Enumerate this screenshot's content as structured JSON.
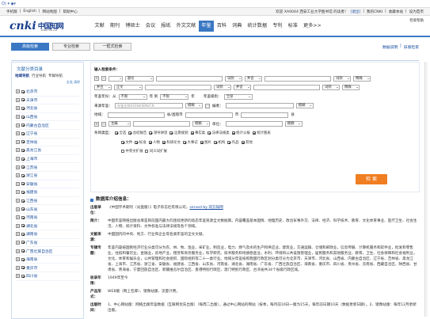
{
  "browser": {
    "dots": "O) ▾ ◆▾"
  },
  "topbar": {
    "links": [
      "手机版",
      "English",
      "网站地图",
      "帮助中心"
    ],
    "welcome": "欢迎 XA0044 西安工业大学图书馆 的读者！",
    "exit": "[退出]",
    "my_cnki": "我的CNKI",
    "collect": "收藏本站",
    "home": "设为首页"
  },
  "logo": {
    "brand": "cnki",
    "cn": "中国知网",
    "sub": "www.cnki.net"
  },
  "nav": {
    "items": [
      "文献",
      "期刊",
      "博硕士",
      "会议",
      "报纸",
      "外文文献",
      "年鉴",
      "百科",
      "词典",
      "统计数据",
      "专利",
      "标准",
      "更多>>"
    ],
    "active": "年鉴"
  },
  "header_util": {
    "help": "检索帮助",
    "feedback": "建议反馈"
  },
  "tabs": [
    "高级检索",
    "专业检索",
    "一框式检索"
  ],
  "right_links": {
    "new_func": "数据说明",
    "old": "旧版检索"
  },
  "side": {
    "title": "文献分类目录",
    "tabs": [
      "地域导航",
      "行业导航",
      "专辑导航"
    ],
    "select_all": "全选",
    "clear": "清除",
    "items": [
      "北京市",
      "天津市",
      "河北省",
      "山西省",
      "内蒙古自治区",
      "辽宁省",
      "吉林省",
      "黑龙江省",
      "上海市",
      "江苏省",
      "浙江省",
      "安徽省",
      "福建省",
      "江西省",
      "山东省",
      "河南省",
      "湖北省",
      "湖南省",
      "广东省",
      "广西壮族自治区",
      "海南省",
      "重庆市",
      "四川省"
    ]
  },
  "form": {
    "title": "输入检索条件：",
    "r1": {
      "field": "题名",
      "freq": "词频",
      "logic": "并含",
      "freq2": "词频",
      "match": "精确"
    },
    "r2": {
      "op": "并且",
      "field": "正文",
      "freq": "词频",
      "logic": "并含",
      "freq2": "词频",
      "match": "精确"
    },
    "year_label": "年鉴年份：从",
    "year_from": "不限",
    "year_to_label": "年 到",
    "year_to": "不限",
    "year_unit": "年",
    "level_label": "年鉴级别：",
    "level": "全部",
    "source_label": "来源年鉴：",
    "source_placeholder": "年鉴名称/ISSN/ISBN/CN",
    "source_match": "模糊",
    "editor_label": "编者：",
    "editor_match": "模糊",
    "region_label": "地域：",
    "province": "省/直辖市",
    "city": "市",
    "county": "县",
    "author_field": "主编",
    "author_match": "模糊",
    "unit_label": "单位：",
    "unit_match": "模糊",
    "type_label": "条目类型：",
    "types1": [
      "全选",
      "总结报告",
      "领导讲话",
      "远景规划",
      "事实类",
      "法律法规类",
      "统计公报",
      "统计图表"
    ],
    "types2": [
      "文件",
      "标准",
      "人物",
      "科研论文",
      "大事记",
      "图片",
      "机构",
      "作品",
      "其他"
    ],
    "options": [
      "中英文扩展",
      "同义词扩展"
    ],
    "search": "检 索"
  },
  "intro": {
    "heading": "数据库介绍信息：",
    "rows": [
      {
        "k": "出版单位：",
        "v": "《中国学术期刊（光盘版）》电子杂志社有限公司，",
        "link": "served by 同方知网"
      },
      {
        "k": "简介：",
        "v": "中国年鉴网络出版总库是目前国内最大的连续更新的动态年鉴资源全文数据库。内容覆盖基本国情、地理历史、政治军事外交、法律、经济、科学技术、教育、文化体育事业、医疗卫生、社会生活、人物、统计资料、文件标准与法律法规等各个领域。"
      },
      {
        "k": "文献来源：",
        "v": "中国国内的中央、地方、行业和企业等各类年鉴的全文文献。"
      },
      {
        "k": "专辑专题：",
        "v": "年鉴内容按国民经济行业分类可分为农、林、牧、渔业，采矿业，制造业，电力、燃气及水的生产和供应业，建筑业，交通运输、仓储和邮政业，信息传输、计算机服务和软件业，批发和零售业，住宿和餐饮业，金融业，房地产业，租赁和商务服务业，科学研究、技术服务和地质勘查业，水利、环境和公共设施管理业，居民服务和其他服务业，教育，卫生、社会保障和社会福利业，文化、体育和娱乐业，公共管理和社会组织、国际组织等二十一类行业。地域分年鉴按照我国行政区划分类可分为北京市、天津市、河北省、山西省、内蒙古自治区、辽宁省、吉林省、黑龙江省、上海市、江苏省、浙江省、安徽省、福建省、江西省、山东省、河南省、湖北省、湖南省、广东省、广西壮族自治区、海南省、重庆市、四川省、贵州省、云南省、西藏自治区、陕西省、甘肃省、青海省、宁夏回族自治区、新疆维吾尔自治区、香港特别行政区、澳门特别行政区、台湾省共34个省级行政区域。"
      },
      {
        "k": "收录年限：",
        "v": "1949年至今"
      },
      {
        "k": "产品形式：",
        "v": "WEB版（网上包库）、镜像站版、流量计费。"
      },
      {
        "k": "出版时间：",
        "v": "1、中心网站版：网络出版年鉴数据（互联网优先出版）（每周二出版），通过中心网站的网站（按季，每月前10日一版为15天，每年前日期10天（数据更新日期）。2、镜像站版：每年12月更新出版。"
      }
    ]
  },
  "colors": {
    "accent": "#3a78c3",
    "search": "#f07e22",
    "link": "#1a4fa0"
  }
}
